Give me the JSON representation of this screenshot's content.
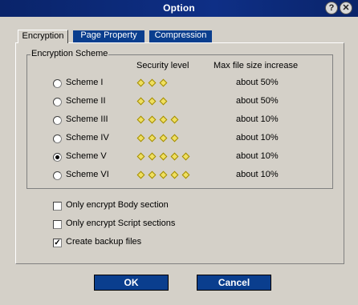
{
  "window": {
    "title": "Option",
    "help_label": "?",
    "close_label": "✕"
  },
  "tabs": [
    {
      "label": "Encryption"
    },
    {
      "label": "Page Property"
    },
    {
      "label": "Compression"
    }
  ],
  "encryption": {
    "group_title": "Encryption Scheme",
    "col_security": "Security level",
    "col_size": "Max file size increase",
    "selected": "Scheme V",
    "schemes": [
      {
        "label": "Scheme I",
        "level": 3,
        "size": "about 50%"
      },
      {
        "label": "Scheme II",
        "level": 3,
        "size": "about 50%"
      },
      {
        "label": "Scheme III",
        "level": 4,
        "size": "about 10%"
      },
      {
        "label": "Scheme IV",
        "level": 4,
        "size": "about 10%"
      },
      {
        "label": "Scheme V",
        "level": 5,
        "size": "about 10%"
      },
      {
        "label": "Scheme VI",
        "level": 5,
        "size": "about 10%"
      }
    ]
  },
  "options": [
    {
      "label": "Only encrypt Body section",
      "checked": false
    },
    {
      "label": "Only encrypt Script sections",
      "checked": false
    },
    {
      "label": "Create backup files",
      "checked": true
    }
  ],
  "buttons": {
    "ok": "OK",
    "cancel": "Cancel"
  },
  "colors": {
    "titlebar": "#0a246a",
    "tab_inactive": "#0a3e8e",
    "face": "#d4d0c8",
    "diamond": "#f0e060"
  }
}
